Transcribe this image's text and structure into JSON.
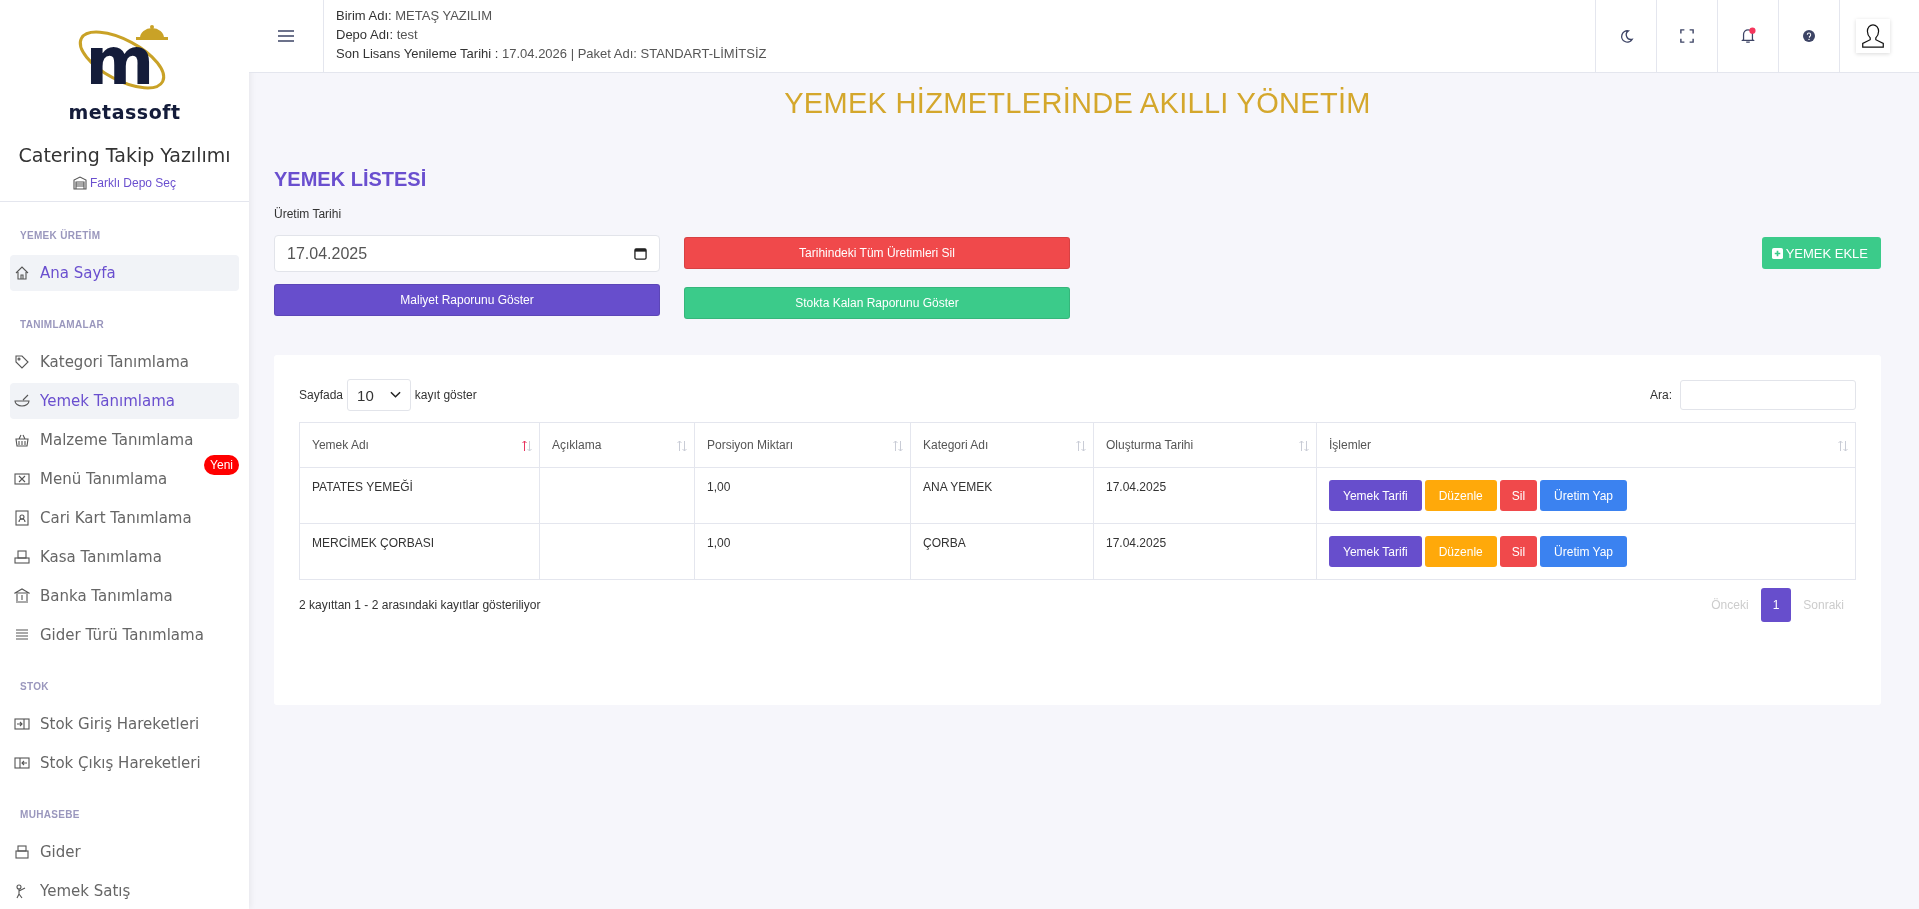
{
  "sidebar": {
    "logo": {
      "mark": "m",
      "name": "metassoft"
    },
    "app_title": "Catering Takip Yazılımı",
    "depot_link": "Farklı Depo Seç",
    "sections": [
      {
        "title": "YEMEK ÜRETİM",
        "items": [
          {
            "label": "Ana Sayfa",
            "selected": true
          }
        ]
      },
      {
        "title": "TANIMLAMALAR",
        "items": [
          {
            "label": "Kategori Tanımlama",
            "selected": false
          },
          {
            "label": "Yemek Tanımlama",
            "selected": true
          },
          {
            "label": "Malzeme Tanımlama",
            "selected": false
          },
          {
            "label": "Menü Tanımlama",
            "selected": false,
            "badge": "Yeni"
          },
          {
            "label": "Cari Kart Tanımlama",
            "selected": false
          },
          {
            "label": "Kasa Tanımlama",
            "selected": false
          },
          {
            "label": "Banka Tanımlama",
            "selected": false
          },
          {
            "label": "Gider Türü Tanımlama",
            "selected": false
          }
        ]
      },
      {
        "title": "STOK",
        "items": [
          {
            "label": "Stok Giriş Hareketleri",
            "selected": false
          },
          {
            "label": "Stok Çıkış Hareketleri",
            "selected": false
          }
        ]
      },
      {
        "title": "MUHASEBE",
        "items": [
          {
            "label": "Gider",
            "selected": false
          },
          {
            "label": "Yemek Satış",
            "selected": false
          }
        ]
      }
    ]
  },
  "header": {
    "info_lines": [
      {
        "label": "Birim Adı:",
        "value": "METAŞ YAZILIM"
      },
      {
        "label": "Depo Adı:",
        "value": "test"
      },
      {
        "label": "Son Lisans Yenileme Tarihi :",
        "value": "17.04.2026 | Paket Adı: STANDART-LİMİTSİZ"
      }
    ],
    "notification_unread": true
  },
  "banner": "YEMEK HİZMETLERİNDE AKILLI YÖNETİM",
  "page_title": "YEMEK LİSTESİ",
  "production_date": {
    "label": "Üretim Tarihi",
    "value": "17.04.2025"
  },
  "action_buttons": [
    {
      "label": "Tarihindeki Tüm Üretimleri Sil",
      "kind": "danger"
    },
    {
      "label": "Maliyet Raporunu Göster",
      "kind": "primary"
    },
    {
      "label": "Stokta Kalan Raporunu Göster",
      "kind": "success"
    }
  ],
  "add_button": "YEMEK EKLE",
  "table": {
    "page_size_prefix": "Sayfada",
    "page_size": "10",
    "page_size_suffix": "kayıt göster",
    "search_label": "Ara:",
    "columns": [
      {
        "label": "Yemek Adı",
        "sorted": true
      },
      {
        "label": "Açıklama",
        "sorted": false
      },
      {
        "label": "Porsiyon Miktarı",
        "sorted": false
      },
      {
        "label": "Kategori Adı",
        "sorted": false
      },
      {
        "label": "Oluşturma Tarihi",
        "sorted": false
      },
      {
        "label": "İşlemler",
        "sorted": false
      }
    ],
    "rows": [
      {
        "cells": [
          "PATATES YEMEĞİ",
          "",
          "1,00",
          "ANA YEMEK",
          "17.04.2025"
        ],
        "actions": [
          {
            "label": "Yemek Tarifi",
            "kind": "recipe"
          },
          {
            "label": "Düzenle",
            "kind": "edit"
          },
          {
            "label": "Sil",
            "kind": "delete"
          },
          {
            "label": "Üretim Yap",
            "kind": "produce"
          }
        ]
      },
      {
        "cells": [
          "MERCİMEK ÇORBASI",
          "",
          "1,00",
          "ÇORBA",
          "17.04.2025"
        ],
        "actions": [
          {
            "label": "Yemek Tarifi",
            "kind": "recipe"
          },
          {
            "label": "Düzenle",
            "kind": "edit"
          },
          {
            "label": "Sil",
            "kind": "delete"
          },
          {
            "label": "Üretim Yap",
            "kind": "produce"
          }
        ]
      }
    ],
    "info": "2 kayıttan 1 - 2 arasındaki kayıtlar gösteriliyor",
    "pagination": [
      {
        "label": "Önceki",
        "selected": false,
        "disabled": true
      },
      {
        "label": "1",
        "selected": true,
        "disabled": false
      },
      {
        "label": "Sonraki",
        "selected": false,
        "disabled": true
      }
    ]
  }
}
